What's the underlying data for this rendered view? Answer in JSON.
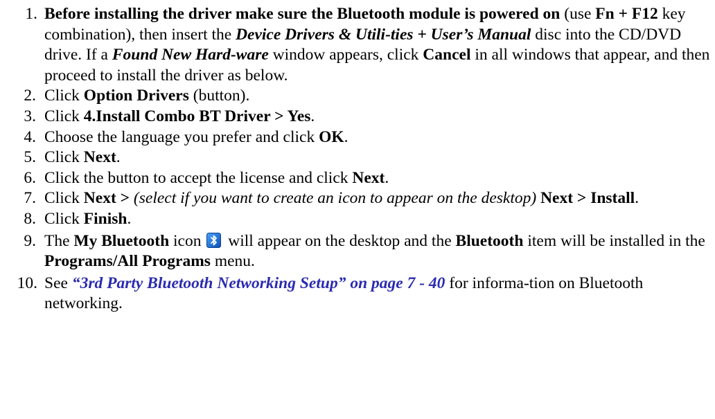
{
  "steps": [
    {
      "num": "1.",
      "t1": "Before installing the driver make sure the Bluetooth module is powered on",
      "t2": " (use ",
      "t3": "Fn + F12",
      "t4": " key combination), then insert the ",
      "t5": "Device Drivers & Utili-ties + User’s Manual",
      "t6": " disc into the CD/DVD drive. If a ",
      "t7": "Found New Hard-ware",
      "t8": " window appears, click ",
      "t9": "Cancel",
      "t10": " in all windows that appear, and then proceed to install the driver as below."
    },
    {
      "num": "2.",
      "t1": "Click ",
      "t2": "Option Drivers",
      "t3": " (button)."
    },
    {
      "num": "3.",
      "t1": "Click ",
      "t2": "4.Install Combo BT Driver > Yes",
      "t3": "."
    },
    {
      "num": "4.",
      "t1": "Choose the language you prefer and click ",
      "t2": "OK",
      "t3": "."
    },
    {
      "num": "5.",
      "t1": "Click ",
      "t2": "Next",
      "t3": "."
    },
    {
      "num": "6.",
      "t1": "Click the button to accept the license and click ",
      "t2": "Next",
      "t3": "."
    },
    {
      "num": "7.",
      "t1": "Click ",
      "t2": "Next >",
      "t3": " (select if you want to create an icon to appear on the desktop)",
      "t4": " Next > Install",
      "t5": "."
    },
    {
      "num": "8.",
      "t1": "Click ",
      "t2": "Finish",
      "t3": "."
    },
    {
      "num": "9.",
      "t1": "The ",
      "t2": "My Bluetooth",
      "t3": " icon ",
      "icon": "bluetooth-icon",
      "t4": " will appear on the desktop and the ",
      "t5": "Bluetooth",
      "t6": " item will be installed in the ",
      "t7": "Programs/All Programs",
      "t8": " menu."
    },
    {
      "num": "10.",
      "t1": "See ",
      "t2": "“3rd Party Bluetooth Networking Setup” on page 7 - 40",
      "t3": " for informa-tion on Bluetooth networking."
    }
  ],
  "colors": {
    "text": "#000000",
    "link": "#2b2bb0",
    "bluetooth_icon_bg": "#1f6fd1"
  }
}
